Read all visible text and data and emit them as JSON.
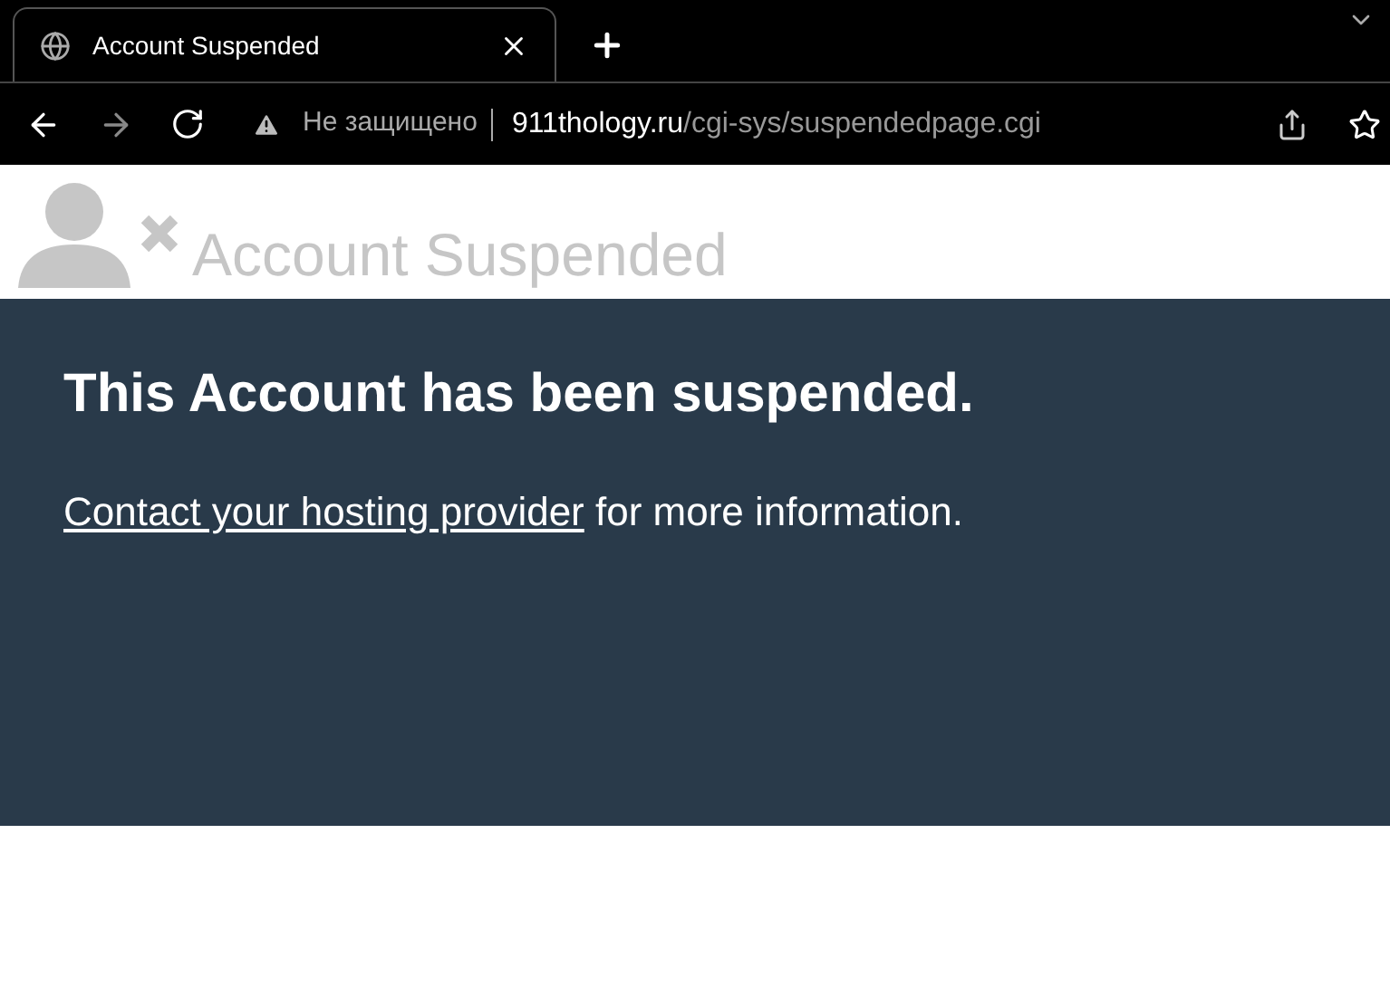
{
  "browser": {
    "tab_title": "Account Suspended",
    "security_label": "Не защищено",
    "url_host": "911thology.ru",
    "url_path": "/cgi-sys/suspendedpage.cgi"
  },
  "page": {
    "header_title": "Account Suspended",
    "heading": "This Account has been suspended.",
    "link": "Contact your hosting provider",
    "text_after_link": " for more information."
  }
}
